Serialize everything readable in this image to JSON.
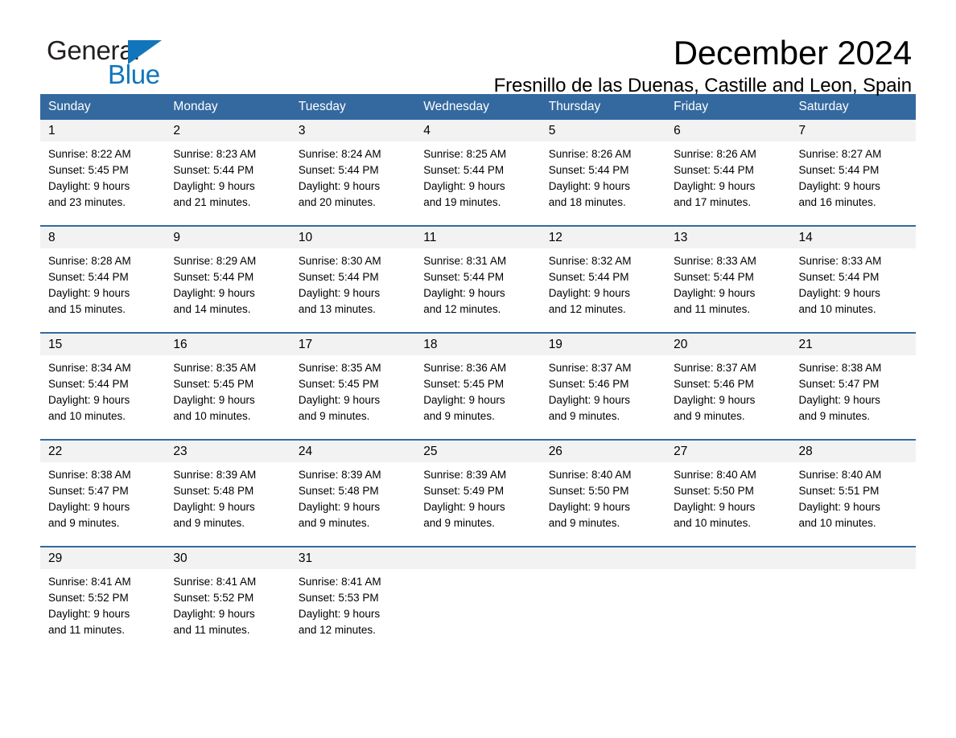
{
  "brand": {
    "name_part1": "General",
    "name_part2": "Blue",
    "triangle_color": "#1175bc"
  },
  "header": {
    "month_title": "December 2024",
    "location": "Fresnillo de las Duenas, Castille and Leon, Spain"
  },
  "theme": {
    "header_blue": "#34699f",
    "day_band_gray": "#f2f2f2",
    "text_black": "#000000",
    "brand_blue": "#1175bc"
  },
  "weekdays": [
    "Sunday",
    "Monday",
    "Tuesday",
    "Wednesday",
    "Thursday",
    "Friday",
    "Saturday"
  ],
  "weeks": [
    {
      "days": [
        {
          "number": "1",
          "sunrise": "Sunrise: 8:22 AM",
          "sunset": "Sunset: 5:45 PM",
          "daylight_1": "Daylight: 9 hours",
          "daylight_2": "and 23 minutes."
        },
        {
          "number": "2",
          "sunrise": "Sunrise: 8:23 AM",
          "sunset": "Sunset: 5:44 PM",
          "daylight_1": "Daylight: 9 hours",
          "daylight_2": "and 21 minutes."
        },
        {
          "number": "3",
          "sunrise": "Sunrise: 8:24 AM",
          "sunset": "Sunset: 5:44 PM",
          "daylight_1": "Daylight: 9 hours",
          "daylight_2": "and 20 minutes."
        },
        {
          "number": "4",
          "sunrise": "Sunrise: 8:25 AM",
          "sunset": "Sunset: 5:44 PM",
          "daylight_1": "Daylight: 9 hours",
          "daylight_2": "and 19 minutes."
        },
        {
          "number": "5",
          "sunrise": "Sunrise: 8:26 AM",
          "sunset": "Sunset: 5:44 PM",
          "daylight_1": "Daylight: 9 hours",
          "daylight_2": "and 18 minutes."
        },
        {
          "number": "6",
          "sunrise": "Sunrise: 8:26 AM",
          "sunset": "Sunset: 5:44 PM",
          "daylight_1": "Daylight: 9 hours",
          "daylight_2": "and 17 minutes."
        },
        {
          "number": "7",
          "sunrise": "Sunrise: 8:27 AM",
          "sunset": "Sunset: 5:44 PM",
          "daylight_1": "Daylight: 9 hours",
          "daylight_2": "and 16 minutes."
        }
      ]
    },
    {
      "days": [
        {
          "number": "8",
          "sunrise": "Sunrise: 8:28 AM",
          "sunset": "Sunset: 5:44 PM",
          "daylight_1": "Daylight: 9 hours",
          "daylight_2": "and 15 minutes."
        },
        {
          "number": "9",
          "sunrise": "Sunrise: 8:29 AM",
          "sunset": "Sunset: 5:44 PM",
          "daylight_1": "Daylight: 9 hours",
          "daylight_2": "and 14 minutes."
        },
        {
          "number": "10",
          "sunrise": "Sunrise: 8:30 AM",
          "sunset": "Sunset: 5:44 PM",
          "daylight_1": "Daylight: 9 hours",
          "daylight_2": "and 13 minutes."
        },
        {
          "number": "11",
          "sunrise": "Sunrise: 8:31 AM",
          "sunset": "Sunset: 5:44 PM",
          "daylight_1": "Daylight: 9 hours",
          "daylight_2": "and 12 minutes."
        },
        {
          "number": "12",
          "sunrise": "Sunrise: 8:32 AM",
          "sunset": "Sunset: 5:44 PM",
          "daylight_1": "Daylight: 9 hours",
          "daylight_2": "and 12 minutes."
        },
        {
          "number": "13",
          "sunrise": "Sunrise: 8:33 AM",
          "sunset": "Sunset: 5:44 PM",
          "daylight_1": "Daylight: 9 hours",
          "daylight_2": "and 11 minutes."
        },
        {
          "number": "14",
          "sunrise": "Sunrise: 8:33 AM",
          "sunset": "Sunset: 5:44 PM",
          "daylight_1": "Daylight: 9 hours",
          "daylight_2": "and 10 minutes."
        }
      ]
    },
    {
      "days": [
        {
          "number": "15",
          "sunrise": "Sunrise: 8:34 AM",
          "sunset": "Sunset: 5:44 PM",
          "daylight_1": "Daylight: 9 hours",
          "daylight_2": "and 10 minutes."
        },
        {
          "number": "16",
          "sunrise": "Sunrise: 8:35 AM",
          "sunset": "Sunset: 5:45 PM",
          "daylight_1": "Daylight: 9 hours",
          "daylight_2": "and 10 minutes."
        },
        {
          "number": "17",
          "sunrise": "Sunrise: 8:35 AM",
          "sunset": "Sunset: 5:45 PM",
          "daylight_1": "Daylight: 9 hours",
          "daylight_2": "and 9 minutes."
        },
        {
          "number": "18",
          "sunrise": "Sunrise: 8:36 AM",
          "sunset": "Sunset: 5:45 PM",
          "daylight_1": "Daylight: 9 hours",
          "daylight_2": "and 9 minutes."
        },
        {
          "number": "19",
          "sunrise": "Sunrise: 8:37 AM",
          "sunset": "Sunset: 5:46 PM",
          "daylight_1": "Daylight: 9 hours",
          "daylight_2": "and 9 minutes."
        },
        {
          "number": "20",
          "sunrise": "Sunrise: 8:37 AM",
          "sunset": "Sunset: 5:46 PM",
          "daylight_1": "Daylight: 9 hours",
          "daylight_2": "and 9 minutes."
        },
        {
          "number": "21",
          "sunrise": "Sunrise: 8:38 AM",
          "sunset": "Sunset: 5:47 PM",
          "daylight_1": "Daylight: 9 hours",
          "daylight_2": "and 9 minutes."
        }
      ]
    },
    {
      "days": [
        {
          "number": "22",
          "sunrise": "Sunrise: 8:38 AM",
          "sunset": "Sunset: 5:47 PM",
          "daylight_1": "Daylight: 9 hours",
          "daylight_2": "and 9 minutes."
        },
        {
          "number": "23",
          "sunrise": "Sunrise: 8:39 AM",
          "sunset": "Sunset: 5:48 PM",
          "daylight_1": "Daylight: 9 hours",
          "daylight_2": "and 9 minutes."
        },
        {
          "number": "24",
          "sunrise": "Sunrise: 8:39 AM",
          "sunset": "Sunset: 5:48 PM",
          "daylight_1": "Daylight: 9 hours",
          "daylight_2": "and 9 minutes."
        },
        {
          "number": "25",
          "sunrise": "Sunrise: 8:39 AM",
          "sunset": "Sunset: 5:49 PM",
          "daylight_1": "Daylight: 9 hours",
          "daylight_2": "and 9 minutes."
        },
        {
          "number": "26",
          "sunrise": "Sunrise: 8:40 AM",
          "sunset": "Sunset: 5:50 PM",
          "daylight_1": "Daylight: 9 hours",
          "daylight_2": "and 9 minutes."
        },
        {
          "number": "27",
          "sunrise": "Sunrise: 8:40 AM",
          "sunset": "Sunset: 5:50 PM",
          "daylight_1": "Daylight: 9 hours",
          "daylight_2": "and 10 minutes."
        },
        {
          "number": "28",
          "sunrise": "Sunrise: 8:40 AM",
          "sunset": "Sunset: 5:51 PM",
          "daylight_1": "Daylight: 9 hours",
          "daylight_2": "and 10 minutes."
        }
      ]
    },
    {
      "days": [
        {
          "number": "29",
          "sunrise": "Sunrise: 8:41 AM",
          "sunset": "Sunset: 5:52 PM",
          "daylight_1": "Daylight: 9 hours",
          "daylight_2": "and 11 minutes."
        },
        {
          "number": "30",
          "sunrise": "Sunrise: 8:41 AM",
          "sunset": "Sunset: 5:52 PM",
          "daylight_1": "Daylight: 9 hours",
          "daylight_2": "and 11 minutes."
        },
        {
          "number": "31",
          "sunrise": "Sunrise: 8:41 AM",
          "sunset": "Sunset: 5:53 PM",
          "daylight_1": "Daylight: 9 hours",
          "daylight_2": "and 12 minutes."
        },
        {
          "number": "",
          "sunrise": "",
          "sunset": "",
          "daylight_1": "",
          "daylight_2": ""
        },
        {
          "number": "",
          "sunrise": "",
          "sunset": "",
          "daylight_1": "",
          "daylight_2": ""
        },
        {
          "number": "",
          "sunrise": "",
          "sunset": "",
          "daylight_1": "",
          "daylight_2": ""
        },
        {
          "number": "",
          "sunrise": "",
          "sunset": "",
          "daylight_1": "",
          "daylight_2": ""
        }
      ]
    }
  ]
}
